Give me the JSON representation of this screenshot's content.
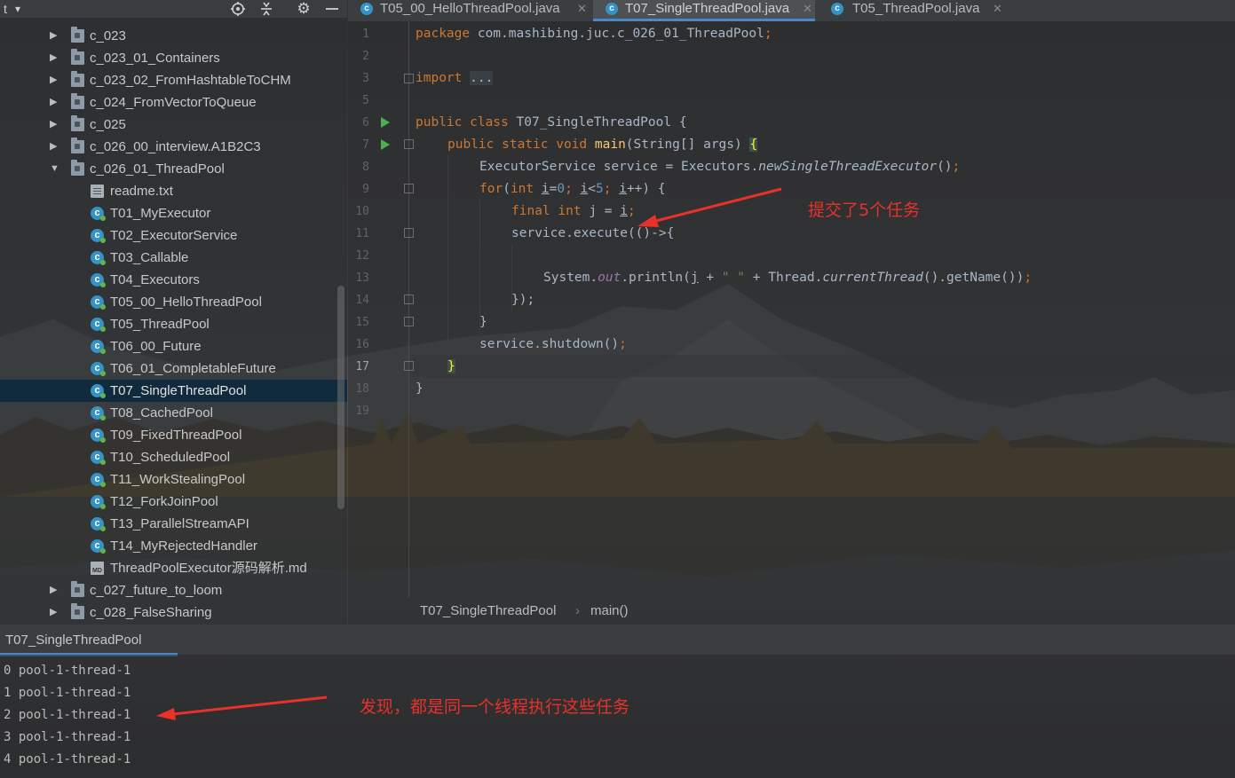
{
  "project_toolbar": {
    "left_glyph": "t",
    "icons": [
      "dropdown-icon",
      "locate-icon",
      "collapse-icon",
      "gear-icon",
      "minimize-icon"
    ]
  },
  "tree": {
    "items": [
      {
        "label": "c_023",
        "kind": "folder",
        "expanded": false
      },
      {
        "label": "c_023_01_Containers",
        "kind": "folder",
        "expanded": false
      },
      {
        "label": "c_023_02_FromHashtableToCHM",
        "kind": "folder",
        "expanded": false
      },
      {
        "label": "c_024_FromVectorToQueue",
        "kind": "folder",
        "expanded": false
      },
      {
        "label": "c_025",
        "kind": "folder",
        "expanded": false
      },
      {
        "label": "c_026_00_interview.A1B2C3",
        "kind": "folder",
        "expanded": false
      },
      {
        "label": "c_026_01_ThreadPool",
        "kind": "folder",
        "expanded": true
      },
      {
        "label": "readme.txt",
        "kind": "text"
      },
      {
        "label": "T01_MyExecutor",
        "kind": "class"
      },
      {
        "label": "T02_ExecutorService",
        "kind": "class"
      },
      {
        "label": "T03_Callable",
        "kind": "class"
      },
      {
        "label": "T04_Executors",
        "kind": "class"
      },
      {
        "label": "T05_00_HelloThreadPool",
        "kind": "class"
      },
      {
        "label": "T05_ThreadPool",
        "kind": "class"
      },
      {
        "label": "T06_00_Future",
        "kind": "class"
      },
      {
        "label": "T06_01_CompletableFuture",
        "kind": "class"
      },
      {
        "label": "T07_SingleThreadPool",
        "kind": "class",
        "selected": true
      },
      {
        "label": "T08_CachedPool",
        "kind": "class"
      },
      {
        "label": "T09_FixedThreadPool",
        "kind": "class"
      },
      {
        "label": "T10_ScheduledPool",
        "kind": "class"
      },
      {
        "label": "T11_WorkStealingPool",
        "kind": "class"
      },
      {
        "label": "T12_ForkJoinPool",
        "kind": "class"
      },
      {
        "label": "T13_ParallelStreamAPI",
        "kind": "class"
      },
      {
        "label": "T14_MyRejectedHandler",
        "kind": "class"
      },
      {
        "label": "ThreadPoolExecutor源码解析.md",
        "kind": "markdown"
      },
      {
        "label": "c_027_future_to_loom",
        "kind": "folder",
        "expanded": false
      },
      {
        "label": "c_028_FalseSharing",
        "kind": "folder",
        "expanded": false
      }
    ]
  },
  "editor_tabs": [
    {
      "label": "T05_00_HelloThreadPool.java",
      "active": false
    },
    {
      "label": "T07_SingleThreadPool.java",
      "active": true
    },
    {
      "label": "T05_ThreadPool.java",
      "active": false
    }
  ],
  "code": {
    "line_numbers": [
      "1",
      "2",
      "3",
      "5",
      "6",
      "7",
      "8",
      "9",
      "10",
      "11",
      "12",
      "13",
      "14",
      "15",
      "16",
      "17",
      "18",
      "19"
    ],
    "current_line": "17",
    "package_kw": "package",
    "package_name": "com.mashibing.juc.c_026_01_ThreadPool",
    "import_kw": "import",
    "import_folded": "...",
    "class_decl": "T07_SingleThreadPool",
    "main_sig": "main",
    "main_params": "(String[] args) ",
    "l8_a": "ExecutorService service = Executors.",
    "l8_b": "newSingleThreadExecutor",
    "l8_c": "()",
    "for_kw": "for",
    "for_a": "(",
    "for_int": "int",
    "for_i": "i",
    "for_eq": "=",
    "for_0": "0",
    "for_i2": "i",
    "for_lt": "<",
    "for_5": "5",
    "for_i3": "i",
    "for_end": "++) {",
    "l10_final": "final",
    "l10_int": "int",
    "l10_rest": "j = ",
    "l10_i": "i",
    "l11": "service.execute(()->{",
    "l13_a": "System.",
    "l13_out": "out",
    "l13_b": ".println(",
    "l13_j": "j",
    "l13_c": " + ",
    "l13_str": "\" \"",
    "l13_d": " + Thread.",
    "l13_cur": "currentThread",
    "l13_e": "().getName())",
    "l14": "});",
    "l15": "}",
    "l16": "service.shutdown()",
    "l17": "}",
    "l18": "}"
  },
  "breadcrumb": {
    "file": "T07_SingleThreadPool",
    "separator": "›",
    "method": "main()"
  },
  "run": {
    "tab_label": "T07_SingleThreadPool",
    "output": [
      "0 pool-1-thread-1",
      "1 pool-1-thread-1",
      "2 pool-1-thread-1",
      "3 pool-1-thread-1",
      "4 pool-1-thread-1"
    ]
  },
  "annotations": {
    "note_tasks": "提交了5个任务",
    "note_same_thread": "发现，都是同一个线程执行这些任务",
    "color": "#e8312a"
  }
}
